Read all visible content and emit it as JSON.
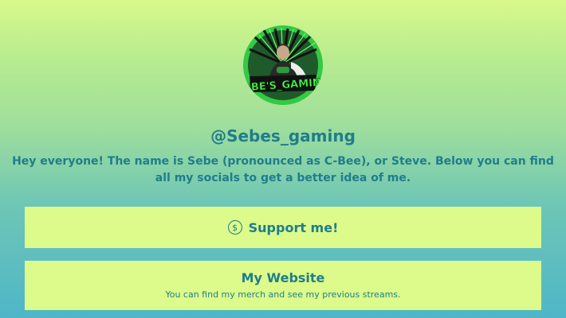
{
  "profile": {
    "handle": "@Sebes_gaming",
    "bio": "Hey everyone! The name is Sebe (pronounced as C-Bee), or Steve. Below you can find all my socials to get a better idea of me.",
    "avatar_icon": "gaming-logo-avatar",
    "avatar_text": "SEBE'S_GAMING"
  },
  "links": [
    {
      "label": "Support me!",
      "icon": "dollar-circle-icon"
    },
    {
      "label": "My Website",
      "description": "You can find my merch and see my previous streams."
    }
  ],
  "colors": {
    "text": "#1f7d8c",
    "button_bg": "#dcfb8a",
    "gradient_top": "#d8f88a",
    "gradient_bottom": "#4fb6c8",
    "avatar_ring": "#3ad24a"
  }
}
